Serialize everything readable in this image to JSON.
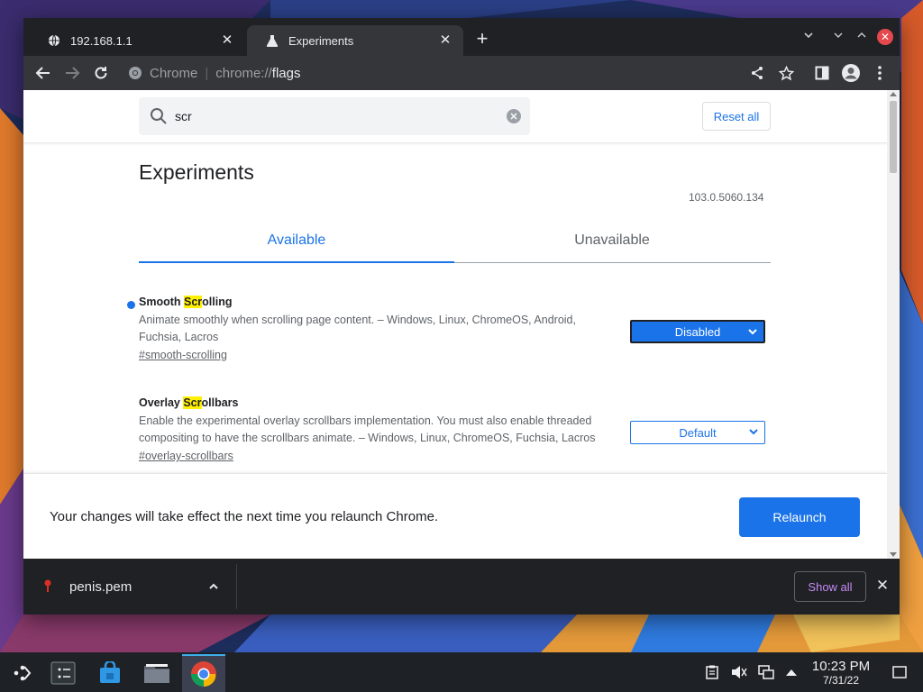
{
  "browser": {
    "tabs": [
      {
        "title": "192.168.1.1",
        "icon": "globe-icon",
        "close": "✕"
      },
      {
        "title": "Experiments",
        "icon": "flask-icon",
        "close": "✕"
      }
    ],
    "new_tab_symbol": "+",
    "omnibox": {
      "site_label": "Chrome",
      "separator": "|",
      "scheme": "chrome://",
      "path": "flags"
    }
  },
  "flags_page": {
    "search_value": "scr",
    "reset_label": "Reset all",
    "title": "Experiments",
    "version": "103.0.5060.134",
    "tabs": {
      "available": "Available",
      "unavailable": "Unavailable"
    },
    "flags": [
      {
        "name_pre": "Smooth ",
        "name_hl": "Scr",
        "name_post": "olling",
        "description": "Animate smoothly when scrolling page content. – Windows, Linux, ChromeOS, Android, Fuchsia, Lacros",
        "link": "#smooth-scrolling",
        "value": "Disabled",
        "modified": true
      },
      {
        "name_pre": "Overlay ",
        "name_hl": "Scr",
        "name_post": "ollbars",
        "description": "Enable the experimental overlay scrollbars implementation. You must also enable threaded compositing to have the scrollbars animate. – Windows, Linux, ChromeOS, Fuchsia, Lacros",
        "link": "#overlay-scrollbars",
        "value": "Default",
        "modified": false
      }
    ],
    "relaunch_message": "Your changes will take effect the next time you relaunch Chrome.",
    "relaunch_label": "Relaunch"
  },
  "downloads": {
    "item_name": "penis.pem",
    "show_all_label": "Show all",
    "close_symbol": "✕"
  },
  "taskbar": {
    "time": "10:23 PM",
    "date": "7/31/22"
  },
  "colors": {
    "accent": "#1a73e8",
    "highlight": "#fff000",
    "tabstrip": "#202124",
    "toolbar": "#35363a"
  }
}
